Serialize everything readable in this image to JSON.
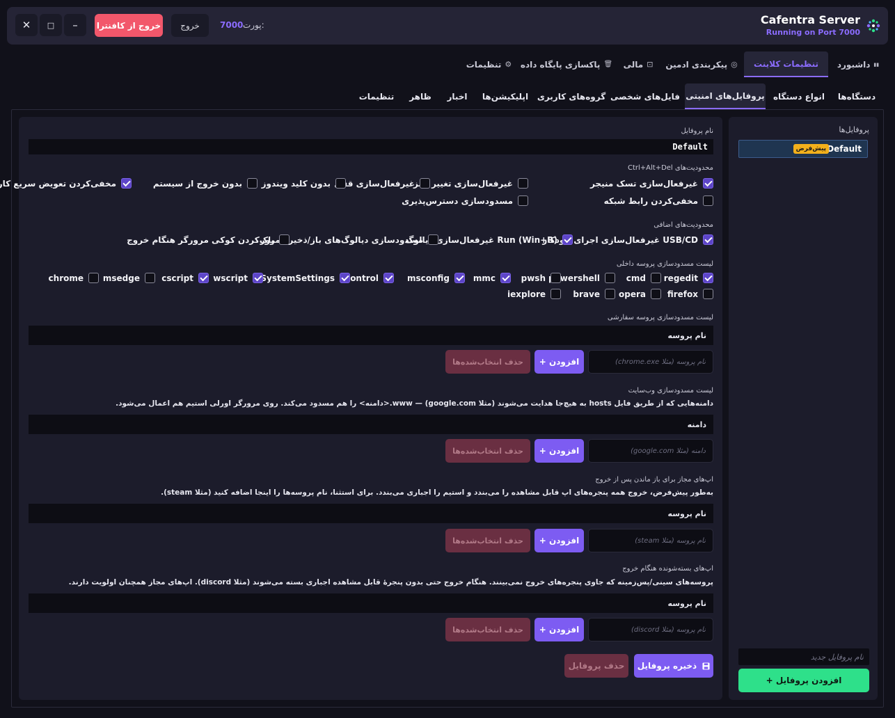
{
  "header": {
    "brand_title": "Cafentra Server",
    "brand_subtitle": "Running on Port 7000",
    "port_label": "پورت:",
    "port_value": "7000",
    "exit_label": "خروج",
    "exit_kafentra_label": "خروج از کافنترا",
    "minimize_label": "–",
    "maximize_label": "□",
    "close_label": "✕"
  },
  "main_tabs": [
    {
      "label": "داشبورد",
      "icon": "bar-chart-icon",
      "glyph": "▮▮"
    },
    {
      "label": "تنظیمات کلاینت",
      "icon": "",
      "glyph": ""
    },
    {
      "label": "پیکربندی ادمین",
      "icon": "shield-icon",
      "glyph": "◎"
    },
    {
      "label": "مالی",
      "icon": "receipt-icon",
      "glyph": "⊡"
    },
    {
      "label": "پاکسازی پایگاه داده",
      "icon": "trash-icon",
      "glyph": "🗑"
    },
    {
      "label": "تنظیمات",
      "icon": "gear-icon",
      "glyph": "⚙"
    }
  ],
  "sub_tabs": [
    "دستگاه‌ها",
    "انواع دستگاه",
    "پروفایل‌های امنیتی",
    "فایل‌های شخصی",
    "گروه‌های کاربری",
    "اپلیکیشن‌ها",
    "اخبار",
    "ظاهر",
    "تنظیمات"
  ],
  "sidebar": {
    "title": "پروفایل‌ها",
    "profile_name": "Default",
    "profile_badge": "پیش‌فرض",
    "new_profile_placeholder": "نام پروفایل جدید",
    "add_profile_label": "+ افزودن پروفایل"
  },
  "form": {
    "profile_name_label": "نام پروفایل",
    "profile_name_value": "Default",
    "cad_label": "محدودیت‌های Ctrl+Alt+Del",
    "cad_options": [
      {
        "label": "غیرفعال‌سازی تسک منیجر",
        "checked": true
      },
      {
        "label": "غیرفعال‌سازی تغییر رمز",
        "checked": false
      },
      {
        "label": "غیرفعال‌سازی قفل",
        "checked": false
      },
      {
        "label": "بدون کلید ویندوز",
        "checked": false
      },
      {
        "label": "بدون خروج از سیستم",
        "checked": false
      },
      {
        "label": "مخفی‌کردن تعویض سریع کاربر",
        "checked": true
      },
      {
        "label": "مخفی‌کردن رابط شبکه",
        "checked": false
      },
      {
        "label": "مسدودسازی دسترس‌پذیری",
        "checked": false
      }
    ],
    "extra_label": "محدودیت‌های اضافی",
    "extra_options": [
      {
        "label": "غیرفعال‌سازی اجرای خودکار USB/CD",
        "checked": true
      },
      {
        "label": "غیرفعال‌سازی دیالوگ Run (Win+R)",
        "checked": true
      },
      {
        "label": "مسدودسازی دیالوگ‌های باز/ذخیره/مرور",
        "checked": false
      },
      {
        "label": "پاک‌کردن کوکی مرورگر هنگام خروج",
        "checked": false
      }
    ],
    "process_label": "لیست مسدودسازی پروسه داخلی",
    "processes": [
      {
        "label": "regedit",
        "checked": true
      },
      {
        "label": "cmd",
        "checked": false
      },
      {
        "label": "powershell",
        "checked": false
      },
      {
        "label": "pwsh",
        "checked": false
      },
      {
        "label": "mmc",
        "checked": true
      },
      {
        "label": "msconfig",
        "checked": true
      },
      {
        "label": "control",
        "checked": true
      },
      {
        "label": "SystemSettings",
        "checked": true
      },
      {
        "label": "wscript",
        "checked": true
      },
      {
        "label": "cscript",
        "checked": true
      },
      {
        "label": "msedge",
        "checked": false
      },
      {
        "label": "chrome",
        "checked": false
      },
      {
        "label": "firefox",
        "checked": false
      },
      {
        "label": "opera",
        "checked": false
      },
      {
        "label": "brave",
        "checked": false
      },
      {
        "label": "iexplore",
        "checked": false
      }
    ],
    "custom_process": {
      "label": "لیست مسدودسازی پروسه سفارشی",
      "column": "نام پروسه",
      "placeholder": "نام پروسه (مثلا chrome.exe)",
      "add_label": "+ افزودن",
      "delete_label": "حذف انتخاب‌شده‌ها"
    },
    "website": {
      "label": "لیست مسدودسازی وب‌سایت",
      "note": "دامنه‌هایی که از طریق فایل hosts به هیچ‌جا هدایت می‌شوند (مثلا google.com) — www.<دامنه> را هم مسدود می‌کند. روی مرورگر اورلی استیم هم اعمال می‌شود.",
      "column": "دامنه",
      "placeholder": "دامنه (مثلا google.com)",
      "add_label": "+ افزودن",
      "delete_label": "حذف انتخاب‌شده‌ها"
    },
    "allowed_apps": {
      "label": "اپ‌های مجاز برای باز ماندن پس از خروج",
      "note": "به‌طور پیش‌فرض، خروج همه پنجره‌های اپ قابل مشاهده را می‌بندد و استیم را اجباری می‌بندد. برای استثنا، نام پروسه‌ها را اینجا اضافه کنید (مثلا steam).",
      "column": "نام پروسه",
      "placeholder": "نام پروسه (مثلا steam)",
      "add_label": "+ افزودن",
      "delete_label": "حذف انتخاب‌شده‌ها"
    },
    "closed_apps": {
      "label": "اپ‌های بسته‌شونده هنگام خروج",
      "note": "پروسه‌های سینی/پس‌زمینه که جاوی پنجره‌های خروج نمی‌بینند. هنگام خروج حتی بدون پنجرهٔ قابل مشاهده اجباری بسته می‌شوند (مثلا discord). اپ‌های مجاز همچنان اولویت دارند.",
      "column": "نام پروسه",
      "placeholder": "نام پروسه (مثلا discord)",
      "add_label": "+ افزودن",
      "delete_label": "حذف انتخاب‌شده‌ها"
    },
    "save_label": "ذخیره پروفایل",
    "delete_profile_label": "حذف پروفایل"
  },
  "colors": {
    "accent": "#7d5cf2",
    "danger": "#f2576b",
    "success": "#2ee08a",
    "badge": "#f2b01b"
  }
}
